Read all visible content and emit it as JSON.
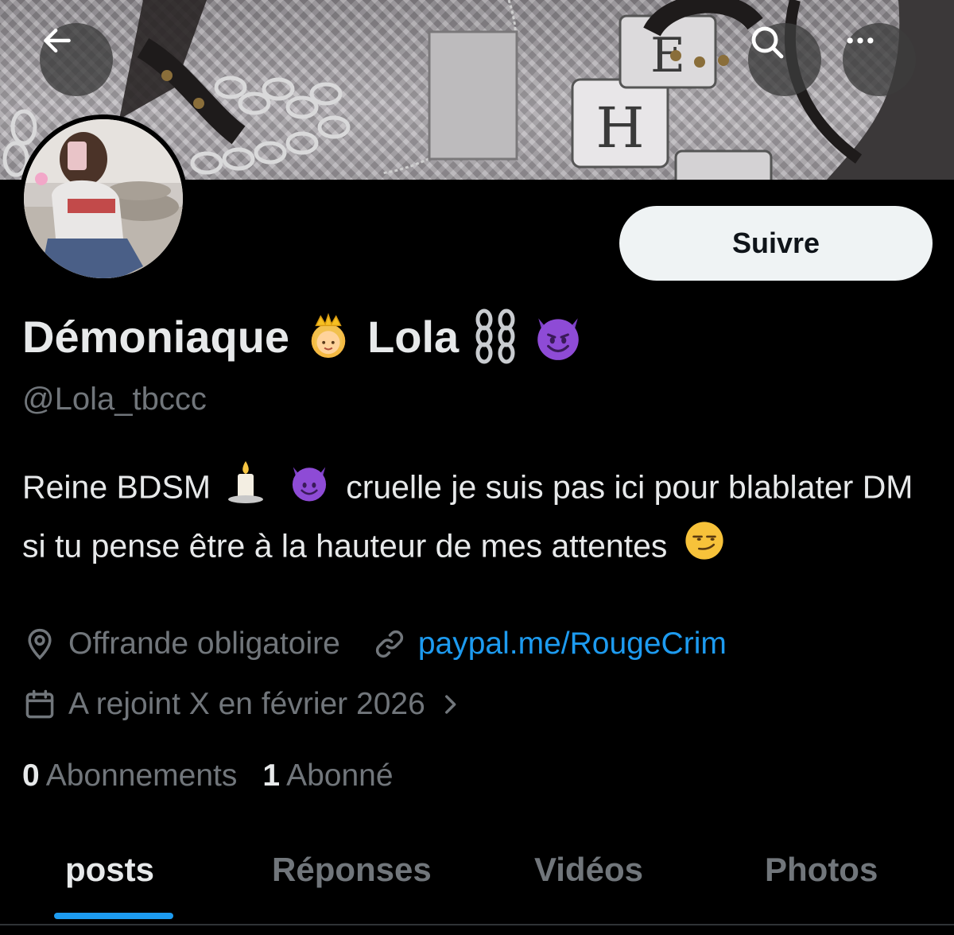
{
  "header": {
    "back_icon": "arrow-left-icon",
    "search_icon": "search-icon",
    "more_icon": "more-horizontal-icon"
  },
  "profile": {
    "display_name": "Démoniaque",
    "display_name_2": "Lola",
    "name_emojis": [
      "princess-emoji",
      "chains-emoji",
      "smiling-devil-emoji"
    ],
    "handle": "@Lola_tbccc",
    "follow_label": "Suivre",
    "bio": {
      "part1": "Reine BDSM",
      "part2": "cruelle je suis pas ici pour blablater DM si tu pense être à la hauteur de mes attentes",
      "emojis": [
        "candle-emoji",
        "smiling-devil-emoji",
        "smirk-emoji"
      ]
    },
    "location": "Offrande obligatoire",
    "link": "paypal.me/RougeCrim",
    "joined": "A rejoint X en février 2026",
    "following_count": "0",
    "following_label": "Abonnements",
    "followers_count": "1",
    "followers_label": "Abonné"
  },
  "tabs": [
    {
      "label": "posts",
      "active": true
    },
    {
      "label": "Réponses",
      "active": false
    },
    {
      "label": "Vidéos",
      "active": false
    },
    {
      "label": "Photos",
      "active": false
    }
  ],
  "colors": {
    "background": "#000000",
    "text_primary": "#e7e9ea",
    "text_secondary": "#71767b",
    "accent": "#1d9bf0",
    "button_bg": "#eff3f4"
  }
}
